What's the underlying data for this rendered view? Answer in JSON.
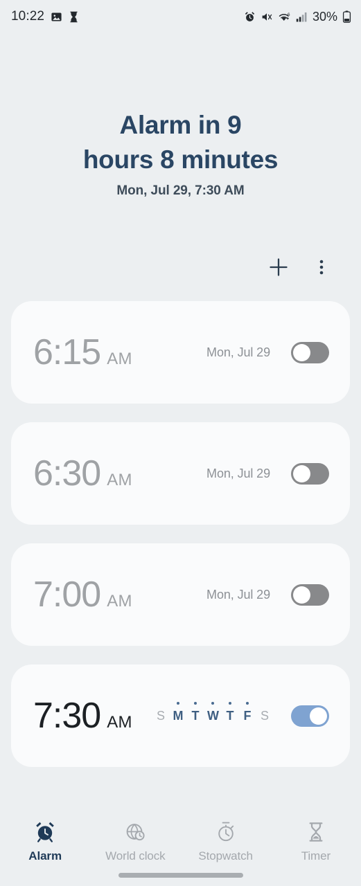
{
  "status_bar": {
    "clock": "10:22",
    "left_icons": [
      "image-icon",
      "hourglass-icon"
    ],
    "right_icons": [
      "alarm-icon",
      "mute-icon",
      "wifi-icon",
      "signal-icon"
    ],
    "battery_percent": "30%",
    "battery_icon": "battery-icon"
  },
  "header": {
    "title_line1": "Alarm in 9",
    "title_line2": "hours 8 minutes",
    "subtitle": "Mon, Jul 29, 7:30 AM",
    "title_color": "#2a4664"
  },
  "actions": {
    "add": {
      "name": "add-alarm-button",
      "icon": "plus-icon"
    },
    "more": {
      "name": "more-options-button",
      "icon": "overflow-menu-icon"
    }
  },
  "alarms": [
    {
      "time": "6:15",
      "meridiem": "AM",
      "schedule_text": "Mon, Jul 29",
      "enabled": false,
      "days": []
    },
    {
      "time": "6:30",
      "meridiem": "AM",
      "schedule_text": "Mon, Jul 29",
      "enabled": false,
      "days": []
    },
    {
      "time": "7:00",
      "meridiem": "AM",
      "schedule_text": "Mon, Jul 29",
      "enabled": false,
      "days": []
    },
    {
      "time": "7:30",
      "meridiem": "AM",
      "schedule_text": "",
      "enabled": true,
      "days": [
        {
          "label": "S",
          "active": false
        },
        {
          "label": "M",
          "active": true
        },
        {
          "label": "T",
          "active": true
        },
        {
          "label": "W",
          "active": true
        },
        {
          "label": "T",
          "active": true
        },
        {
          "label": "F",
          "active": true
        },
        {
          "label": "S",
          "active": false
        }
      ]
    }
  ],
  "colors": {
    "page_bg": "#eceff1",
    "card_bg": "#fafbfc",
    "accent_navy": "#1f3a57",
    "toggle_on": "#7fa3d1",
    "toggle_off": "#88898b",
    "day_active": "#3f5f82"
  },
  "bottom_nav": {
    "tabs": [
      {
        "label": "Alarm",
        "icon": "alarm-clock-icon",
        "active": true
      },
      {
        "label": "World clock",
        "icon": "globe-clock-icon",
        "active": false
      },
      {
        "label": "Stopwatch",
        "icon": "stopwatch-icon",
        "active": false
      },
      {
        "label": "Timer",
        "icon": "hourglass-icon",
        "active": false
      }
    ]
  }
}
